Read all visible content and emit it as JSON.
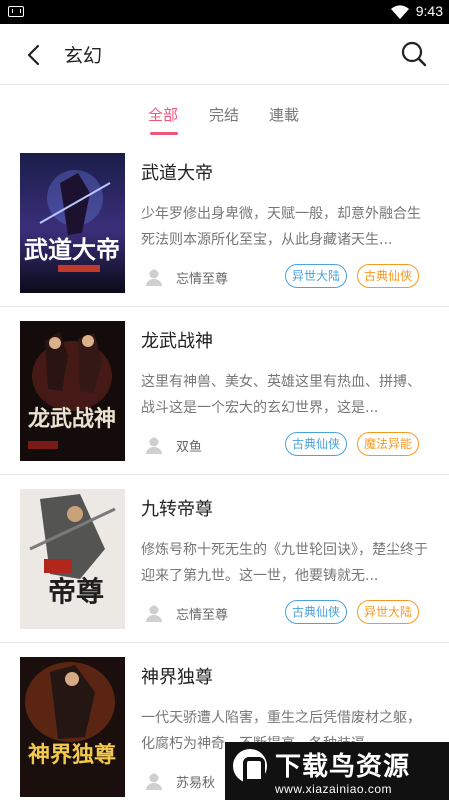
{
  "status_bar": {
    "time": "9:43"
  },
  "header": {
    "title": "玄幻",
    "back_icon": "back-arrow-icon",
    "search_icon": "search-icon"
  },
  "tabs": [
    {
      "label": "全部",
      "active": true
    },
    {
      "label": "完结",
      "active": false
    },
    {
      "label": "連載",
      "active": false
    }
  ],
  "books": [
    {
      "title": "武道大帝",
      "description": "少年罗修出身卑微，天赋一般，却意外融合生死法则本源所化至宝，从此身藏诸天生...",
      "author": "忘情至尊",
      "tags": [
        {
          "label": "异世大陆",
          "color": "blue"
        },
        {
          "label": "古典仙侠",
          "color": "orange"
        }
      ],
      "cover_text": "武道大帝"
    },
    {
      "title": "龙武战神",
      "description": "这里有神兽、美女、英雄这里有热血、拼搏、战斗这是一个宏大的玄幻世界，这是...",
      "author": "双鱼",
      "tags": [
        {
          "label": "古典仙侠",
          "color": "blue"
        },
        {
          "label": "魔法异能",
          "color": "orange"
        }
      ],
      "cover_text": "龙武战神"
    },
    {
      "title": "九转帝尊",
      "description": "修炼号称十死无生的《九世轮回诀》，楚尘终于迎来了第九世。这一世，他要铸就无...",
      "author": "忘情至尊",
      "tags": [
        {
          "label": "古典仙侠",
          "color": "blue"
        },
        {
          "label": "异世大陆",
          "color": "orange"
        }
      ],
      "cover_text": "帝尊"
    },
    {
      "title": "神界独尊",
      "description": "一代天骄遭人陷害，重生之后凭借废材之躯，化腐朽为神奇，不断提高，各种装逼...",
      "author": "苏易秋",
      "tags": [],
      "cover_text": "神界独尊"
    }
  ],
  "watermark": {
    "title": "下载鸟资源",
    "url": "www.xiazainiao.com"
  },
  "colors": {
    "accent": "#f0557a",
    "tag_blue": "#4aa3df",
    "tag_orange": "#f59a23"
  }
}
